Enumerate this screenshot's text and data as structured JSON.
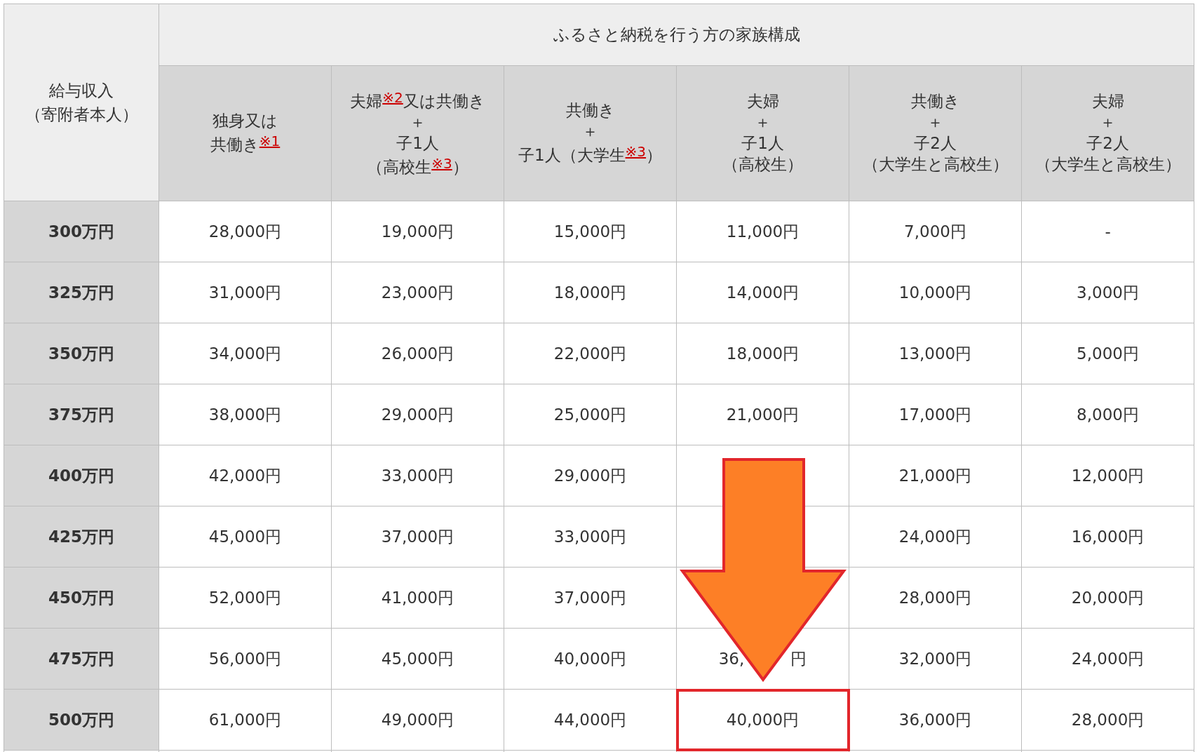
{
  "table": {
    "corner_header": [
      "給与収入",
      "（寄附者本人）"
    ],
    "group_header": "ふるさと納税を行う方の家族構成",
    "columns": [
      {
        "lines": [
          [
            {
              "text": "独身又は"
            }
          ],
          [
            {
              "text": "共働き"
            },
            {
              "text": "※1",
              "kind": "note"
            }
          ]
        ]
      },
      {
        "lines": [
          [
            {
              "text": "夫婦"
            },
            {
              "text": "※2",
              "kind": "note"
            },
            {
              "text": "又は共働き"
            }
          ],
          [
            {
              "text": "＋"
            }
          ],
          [
            {
              "text": "子1人"
            }
          ],
          [
            {
              "text": "（高校生"
            },
            {
              "text": "※3",
              "kind": "note"
            },
            {
              "text": "）"
            }
          ]
        ]
      },
      {
        "lines": [
          [
            {
              "text": "共働き"
            }
          ],
          [
            {
              "text": "＋"
            }
          ],
          [
            {
              "text": "子1人（大学生"
            },
            {
              "text": "※3",
              "kind": "note"
            },
            {
              "text": "）"
            }
          ]
        ]
      },
      {
        "lines": [
          [
            {
              "text": "夫婦"
            }
          ],
          [
            {
              "text": "＋"
            }
          ],
          [
            {
              "text": "子1人"
            }
          ],
          [
            {
              "text": "（高校生）"
            }
          ]
        ]
      },
      {
        "lines": [
          [
            {
              "text": "共働き"
            }
          ],
          [
            {
              "text": "＋"
            }
          ],
          [
            {
              "text": "子2人"
            }
          ],
          [
            {
              "text": "（大学生と高校生）"
            }
          ]
        ]
      },
      {
        "lines": [
          [
            {
              "text": "夫婦"
            }
          ],
          [
            {
              "text": "＋"
            }
          ],
          [
            {
              "text": "子2人"
            }
          ],
          [
            {
              "text": "（大学生と高校生）"
            }
          ]
        ]
      }
    ],
    "rows": [
      {
        "income": "300万円",
        "cells": [
          {
            "kind": "text",
            "text": "28,000円",
            "highlighted": false
          },
          {
            "kind": "text",
            "text": "19,000円",
            "highlighted": false
          },
          {
            "kind": "text",
            "text": "15,000円",
            "highlighted": false
          },
          {
            "kind": "text",
            "text": "11,000円",
            "highlighted": false
          },
          {
            "kind": "text",
            "text": "7,000円",
            "highlighted": false
          },
          {
            "kind": "text",
            "text": "-",
            "highlighted": false
          }
        ]
      },
      {
        "income": "325万円",
        "cells": [
          {
            "kind": "text",
            "text": "31,000円",
            "highlighted": false
          },
          {
            "kind": "text",
            "text": "23,000円",
            "highlighted": false
          },
          {
            "kind": "text",
            "text": "18,000円",
            "highlighted": false
          },
          {
            "kind": "text",
            "text": "14,000円",
            "highlighted": false
          },
          {
            "kind": "text",
            "text": "10,000円",
            "highlighted": false
          },
          {
            "kind": "text",
            "text": "3,000円",
            "highlighted": false
          }
        ]
      },
      {
        "income": "350万円",
        "cells": [
          {
            "kind": "text",
            "text": "34,000円",
            "highlighted": false
          },
          {
            "kind": "text",
            "text": "26,000円",
            "highlighted": false
          },
          {
            "kind": "text",
            "text": "22,000円",
            "highlighted": false
          },
          {
            "kind": "text",
            "text": "18,000円",
            "highlighted": false
          },
          {
            "kind": "text",
            "text": "13,000円",
            "highlighted": false
          },
          {
            "kind": "text",
            "text": "5,000円",
            "highlighted": false
          }
        ]
      },
      {
        "income": "375万円",
        "cells": [
          {
            "kind": "text",
            "text": "38,000円",
            "highlighted": false
          },
          {
            "kind": "text",
            "text": "29,000円",
            "highlighted": false
          },
          {
            "kind": "text",
            "text": "25,000円",
            "highlighted": false
          },
          {
            "kind": "text",
            "text": "21,000円",
            "highlighted": false
          },
          {
            "kind": "text",
            "text": "17,000円",
            "highlighted": false
          },
          {
            "kind": "text",
            "text": "8,000円",
            "highlighted": false
          }
        ]
      },
      {
        "income": "400万円",
        "cells": [
          {
            "kind": "text",
            "text": "42,000円",
            "highlighted": false
          },
          {
            "kind": "text",
            "text": "33,000円",
            "highlighted": false
          },
          {
            "kind": "text",
            "text": "29,000円",
            "highlighted": false
          },
          {
            "kind": "covered",
            "highlighted": false
          },
          {
            "kind": "text",
            "text": "21,000円",
            "highlighted": false
          },
          {
            "kind": "text",
            "text": "12,000円",
            "highlighted": false
          }
        ]
      },
      {
        "income": "425万円",
        "cells": [
          {
            "kind": "text",
            "text": "45,000円",
            "highlighted": false
          },
          {
            "kind": "text",
            "text": "37,000円",
            "highlighted": false
          },
          {
            "kind": "text",
            "text": "33,000円",
            "highlighted": false
          },
          {
            "kind": "covered",
            "highlighted": false
          },
          {
            "kind": "text",
            "text": "24,000円",
            "highlighted": false
          },
          {
            "kind": "text",
            "text": "16,000円",
            "highlighted": false
          }
        ]
      },
      {
        "income": "450万円",
        "cells": [
          {
            "kind": "text",
            "text": "52,000円",
            "highlighted": false
          },
          {
            "kind": "text",
            "text": "41,000円",
            "highlighted": false
          },
          {
            "kind": "text",
            "text": "37,000円",
            "highlighted": false
          },
          {
            "kind": "covered",
            "highlighted": false
          },
          {
            "kind": "text",
            "text": "28,000円",
            "highlighted": false
          },
          {
            "kind": "text",
            "text": "20,000円",
            "highlighted": false
          }
        ]
      },
      {
        "income": "475万円",
        "cells": [
          {
            "kind": "text",
            "text": "56,000円",
            "highlighted": false
          },
          {
            "kind": "text",
            "text": "45,000円",
            "highlighted": false
          },
          {
            "kind": "text",
            "text": "40,000円",
            "highlighted": false
          },
          {
            "kind": "split",
            "parts": [
              "36,",
              "円"
            ],
            "highlighted": false
          },
          {
            "kind": "text",
            "text": "32,000円",
            "highlighted": false
          },
          {
            "kind": "text",
            "text": "24,000円",
            "highlighted": false
          }
        ]
      },
      {
        "income": "500万円",
        "cells": [
          {
            "kind": "text",
            "text": "61,000円",
            "highlighted": false
          },
          {
            "kind": "text",
            "text": "49,000円",
            "highlighted": false
          },
          {
            "kind": "text",
            "text": "44,000円",
            "highlighted": false
          },
          {
            "kind": "text",
            "text": "40,000円",
            "highlighted": true
          },
          {
            "kind": "text",
            "text": "36,000円",
            "highlighted": false
          },
          {
            "kind": "text",
            "text": "28,000円",
            "highlighted": false
          }
        ]
      }
    ]
  }
}
